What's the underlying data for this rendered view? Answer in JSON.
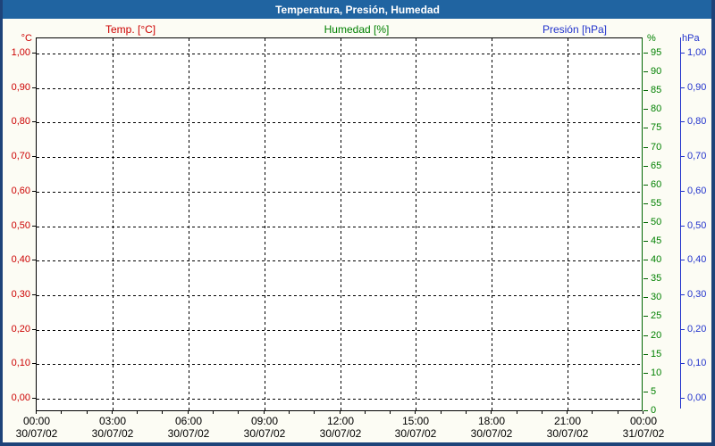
{
  "window": {
    "title": "Temperatura, Presión, Humedad"
  },
  "legend": {
    "temperature": "Temp. [°C]",
    "humidity": "Humedad [%]",
    "pressure": "Presión [hPa]"
  },
  "chart_data": {
    "type": "line",
    "title": "Temperatura, Presión, Humedad",
    "grid": "dashed",
    "plot_empty": "no data series plotted",
    "axes": {
      "temperature": {
        "unit": "°C",
        "legend": "Temp. [°C]",
        "color": "#cc0000",
        "side": "left",
        "ticks": [
          "1,00",
          "0,90",
          "0,80",
          "0,70",
          "0,60",
          "0,50",
          "0,40",
          "0,30",
          "0,20",
          "0,10",
          "0,00"
        ],
        "range": [
          0,
          1
        ]
      },
      "humidity": {
        "unit": "%",
        "legend": "Humedad [%]",
        "color": "#008000",
        "side": "right-inner",
        "ticks": [
          "95",
          "90",
          "85",
          "80",
          "75",
          "70",
          "65",
          "60",
          "55",
          "50",
          "45",
          "40",
          "35",
          "30",
          "25",
          "20",
          "15",
          "10",
          "5",
          "0"
        ],
        "range": [
          0,
          95
        ]
      },
      "pressure": {
        "unit": "hPa",
        "legend": "Presión [hPa]",
        "color": "#2233cc",
        "side": "right-outer",
        "ticks": [
          "1,00",
          "0,90",
          "0,80",
          "0,70",
          "0,60",
          "0,50",
          "0,40",
          "0,30",
          "0,20",
          "0,10",
          "0,00"
        ],
        "range": [
          0,
          1
        ]
      },
      "x": {
        "tick_times": [
          "00:00",
          "03:00",
          "06:00",
          "09:00",
          "12:00",
          "15:00",
          "18:00",
          "21:00",
          "00:00"
        ],
        "tick_dates": [
          "30/07/02",
          "30/07/02",
          "30/07/02",
          "30/07/02",
          "30/07/02",
          "30/07/02",
          "30/07/02",
          "30/07/02",
          "31/07/02"
        ],
        "minor_tick_interval": "1 hour",
        "major_tick_interval": "3 hours"
      }
    },
    "series": [
      {
        "name": "Temp. [°C]",
        "color": "#cc0000",
        "values": []
      },
      {
        "name": "Humedad [%]",
        "color": "#008000",
        "values": []
      },
      {
        "name": "Presión [hPa]",
        "color": "#2233cc",
        "values": []
      }
    ]
  }
}
